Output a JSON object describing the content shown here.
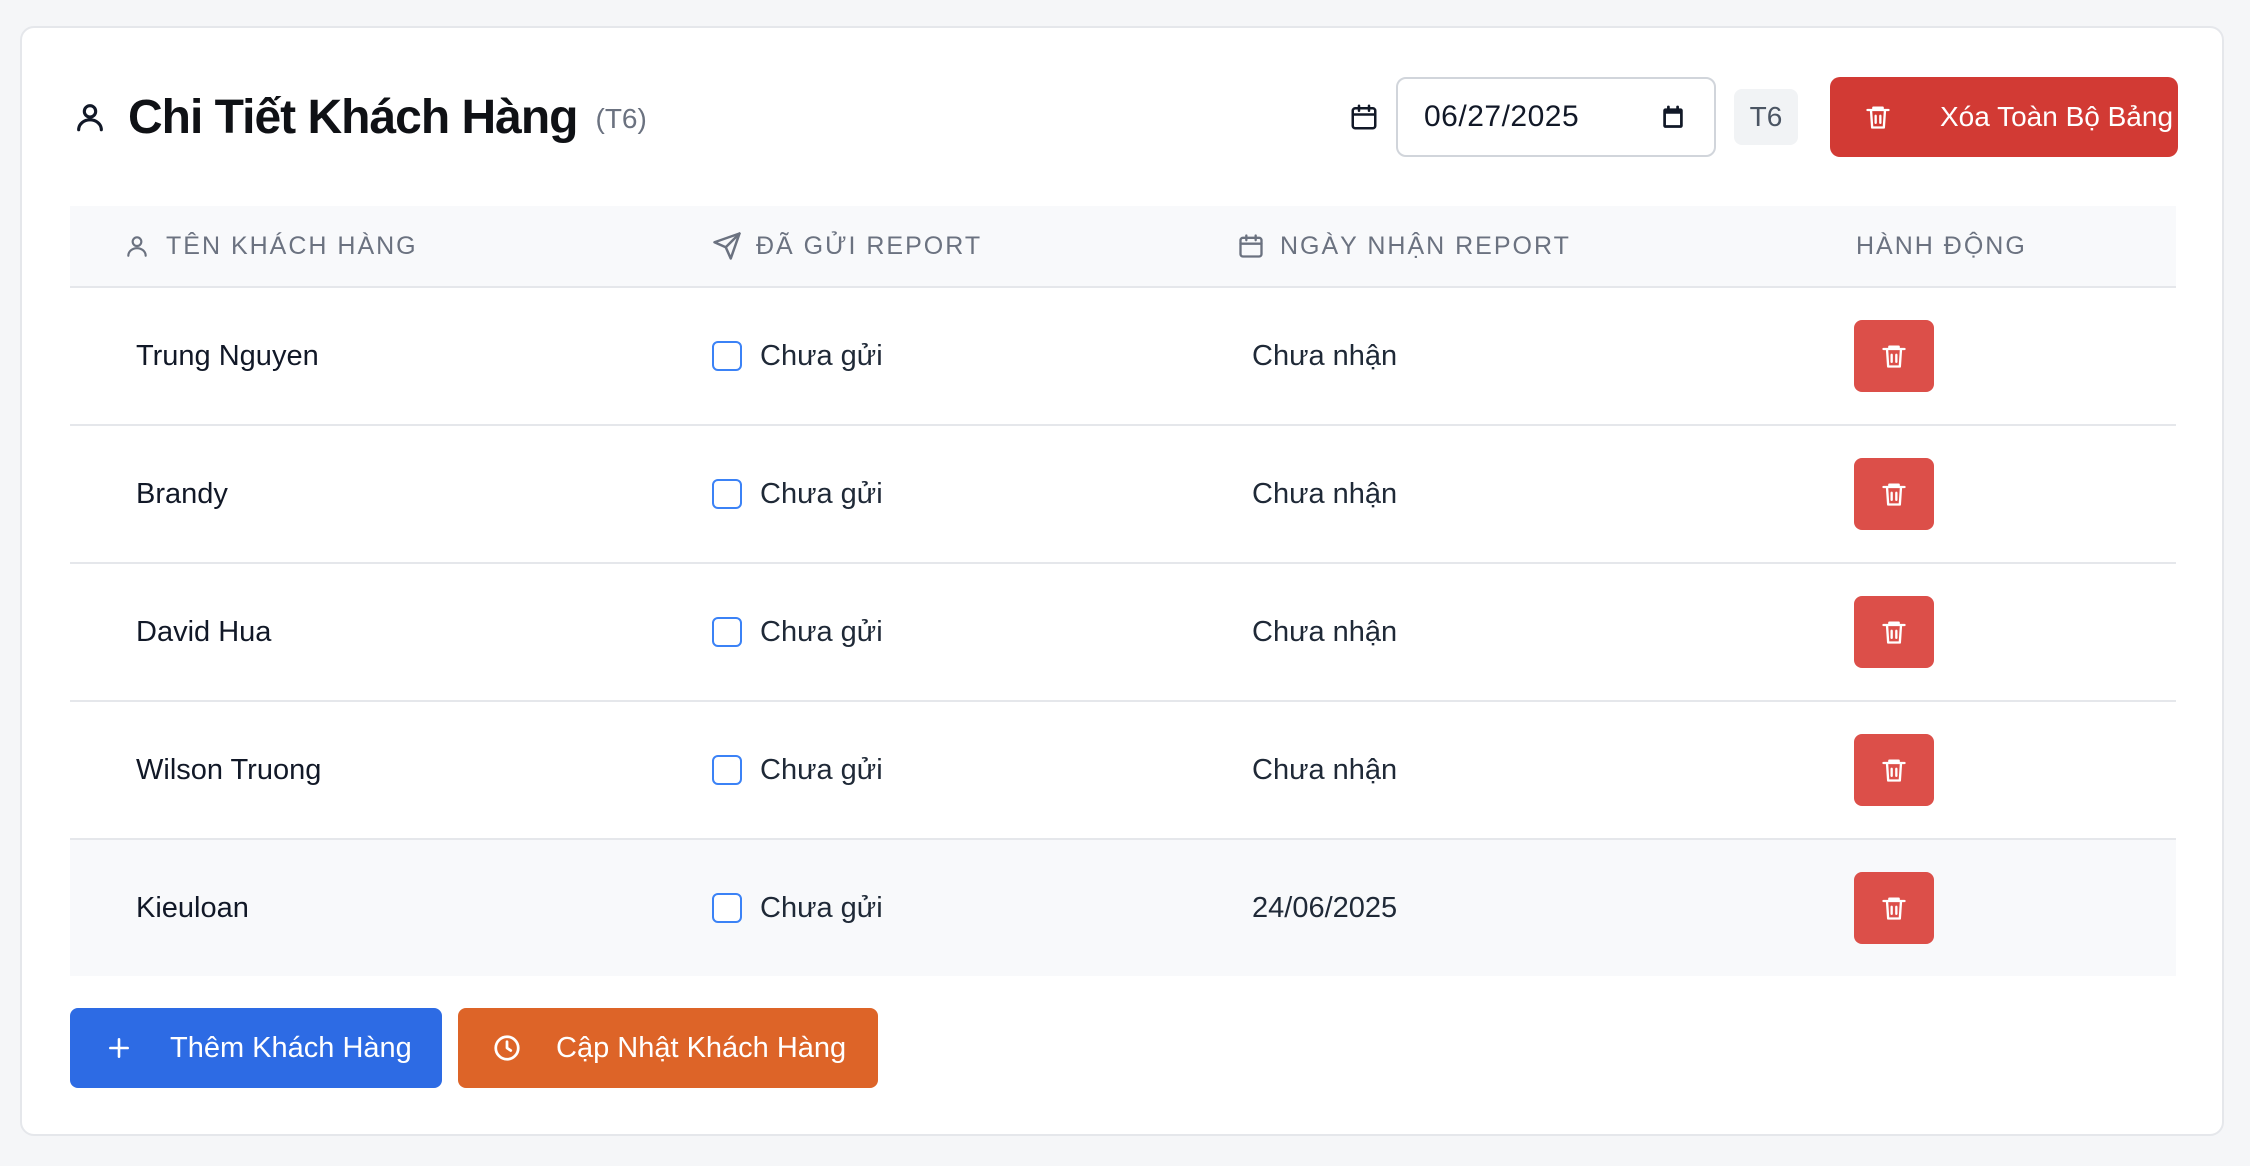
{
  "header": {
    "title": "Chi Tiết Khách Hàng",
    "subtitle": "(T6)",
    "date_value": "06/27/2025",
    "period_badge": "T6",
    "clear_all_label": "Xóa Toàn Bộ Bảng"
  },
  "table": {
    "columns": {
      "name": "TÊN KHÁCH HÀNG",
      "sent": "ĐÃ GỬI REPORT",
      "received": "NGÀY NHẬN REPORT",
      "actions": "HÀNH ĐỘNG"
    },
    "rows": [
      {
        "name": "Trung Nguyen",
        "sent": "Chưa gửi",
        "received": "Chưa nhận"
      },
      {
        "name": "Brandy",
        "sent": "Chưa gửi",
        "received": "Chưa nhận"
      },
      {
        "name": "David Hua",
        "sent": "Chưa gửi",
        "received": "Chưa nhận"
      },
      {
        "name": "Wilson Truong",
        "sent": "Chưa gửi",
        "received": "Chưa nhận"
      },
      {
        "name": "Kieuloan",
        "sent": "Chưa gửi",
        "received": "24/06/2025"
      }
    ]
  },
  "footer": {
    "add_label": "Thêm Khách Hàng",
    "update_label": "Cập Nhật Khách Hàng"
  },
  "colors": {
    "primary": "#2d6be4",
    "danger": "#d23a34",
    "danger_row": "#dc4f49",
    "warning": "#dd6428",
    "checkbox": "#3b82f6"
  },
  "icons": {
    "title": "user-icon",
    "date": "calendar-icon",
    "clear": "trash-icon",
    "col_name": "user-icon",
    "col_sent": "send-icon",
    "col_received": "calendar-icon",
    "add": "plus-icon",
    "update": "clock-icon"
  }
}
